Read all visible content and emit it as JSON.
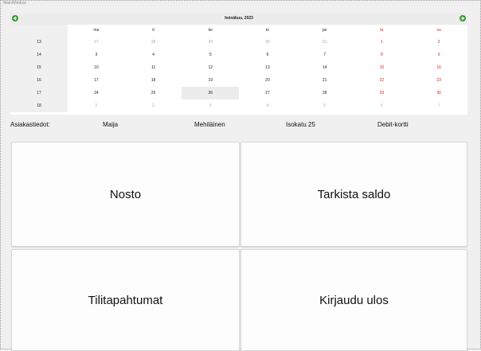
{
  "window": {
    "title": "MainWindow"
  },
  "calendar": {
    "month_label": "heinäkuu,  2023",
    "weekdays": [
      "ma",
      "ti",
      "ke",
      "to",
      "pe",
      "la",
      "su"
    ],
    "weeks": [
      {
        "num": "13",
        "days": [
          "27",
          "28",
          "29",
          "30",
          "31",
          "1",
          "2"
        ]
      },
      {
        "num": "14",
        "days": [
          "3",
          "4",
          "5",
          "6",
          "7",
          "8",
          "9"
        ]
      },
      {
        "num": "15",
        "days": [
          "10",
          "11",
          "12",
          "13",
          "14",
          "15",
          "16"
        ]
      },
      {
        "num": "16",
        "days": [
          "17",
          "18",
          "19",
          "20",
          "21",
          "22",
          "23"
        ]
      },
      {
        "num": "17",
        "days": [
          "24",
          "25",
          "26",
          "27",
          "28",
          "29",
          "30"
        ]
      },
      {
        "num": "18",
        "days": [
          "1",
          "2",
          "3",
          "4",
          "5",
          "6",
          "7"
        ]
      }
    ],
    "selected_day": "26",
    "colors": {
      "weekend": "#e02020",
      "other_month": "#a9a9a9",
      "selected_bg": "#ececec",
      "nav_button": "#3a9a2e"
    }
  },
  "customer": {
    "label": "Asiakastiedot:",
    "first_name": "Maija",
    "last_name": "Mehiläinen",
    "address": "Isokatu 25",
    "card_type": "Debit-kortti"
  },
  "buttons": {
    "withdraw": "Nosto",
    "check_balance": "Tarkista saldo",
    "transactions": "Tilitapahtumat",
    "logout": "Kirjaudu ulos"
  }
}
